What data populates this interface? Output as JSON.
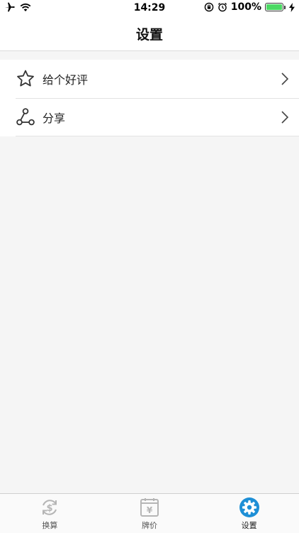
{
  "status_bar": {
    "time": "14:29",
    "battery": "100%",
    "icons": [
      "airplane-icon",
      "wifi-icon",
      "rotation-lock-icon",
      "alarm-icon",
      "battery-icon",
      "charging-icon"
    ]
  },
  "nav": {
    "title": "设置"
  },
  "settings": {
    "items": [
      {
        "label": "给个好评",
        "icon": "star-icon"
      },
      {
        "label": "分享",
        "icon": "share-icon"
      }
    ]
  },
  "tabs": [
    {
      "label": "换算",
      "icon": "dollar-refresh-icon",
      "active": false
    },
    {
      "label": "牌价",
      "icon": "yuan-calendar-icon",
      "active": false
    },
    {
      "label": "设置",
      "icon": "gear-icon",
      "active": true
    }
  ],
  "colors": {
    "accent": "#1e8fd6",
    "inactive_icon": "#b5b5b5",
    "battery": "#4cd964",
    "background": "#f5f5f5"
  }
}
